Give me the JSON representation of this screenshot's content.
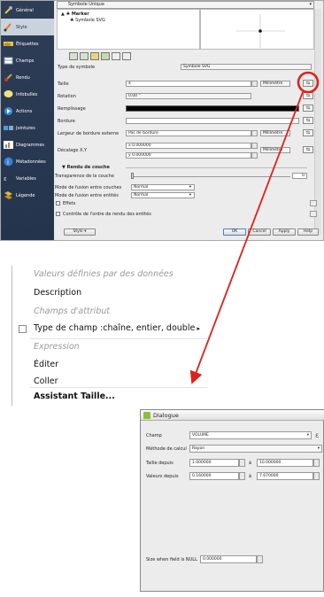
{
  "qgis": {
    "sidebar": [
      {
        "label": "Général",
        "icon": "wrench-icon"
      },
      {
        "label": "Style",
        "icon": "paintbrush-icon"
      },
      {
        "label": "Étiquettes",
        "icon": "labels-icon"
      },
      {
        "label": "Champs",
        "icon": "fields-icon"
      },
      {
        "label": "Rendu",
        "icon": "rendering-icon"
      },
      {
        "label": "Infobulles",
        "icon": "tooltip-icon"
      },
      {
        "label": "Actions",
        "icon": "actions-icon"
      },
      {
        "label": "Jointures",
        "icon": "joins-icon"
      },
      {
        "label": "Diagrammes",
        "icon": "diagram-icon"
      },
      {
        "label": "Métadonnées",
        "icon": "info-icon"
      },
      {
        "label": "Variables",
        "icon": "variables-icon"
      },
      {
        "label": "Légende",
        "icon": "legend-icon"
      }
    ],
    "renderer": "Symbole Unique",
    "tree": {
      "root": "Marker",
      "child": "Symbole SVG"
    },
    "symbol_type_label": "Type de symbole",
    "symbol_type_value": "Symbole SVG",
    "taille_label": "Taille",
    "taille_value": "4",
    "unit_millimetre": "Millimètre",
    "rotation_label": "Rotation",
    "rotation_value": "0.00 °",
    "remplissage_label": "Remplissage",
    "bordure_label": "Bordure",
    "largeur_label": "Largeur de bordure externe",
    "largeur_value": "Pas de bordure",
    "decalage_label": "Décalage X,Y",
    "decalage_x": "x 0.000000",
    "decalage_y": "y 0.000000",
    "section_title": "Rendu de couche",
    "transparence_label": "Transparence de la couche",
    "transparence_value": "0",
    "fusion_couches_label": "Mode de fusion entre couches",
    "fusion_entites_label": "Mode de fusion entre entités",
    "normal": "Normal",
    "effets_label": "Effets",
    "controle_label": "Contrôle de l'ordre de rendu des entités",
    "style_btn": "Style",
    "ok_btn": "OK",
    "cancel_btn": "Cancel",
    "apply_btn": "Apply",
    "help_btn": "Help"
  },
  "menu": {
    "valeurs": "Valeurs définies par des données",
    "description": "Description",
    "champs": "Champs d'attribut",
    "type_champ": "Type de champ :chaîne, entier, double",
    "expression": "Expression",
    "editer": "Éditer",
    "coller": "Coller",
    "assistant": "Assistant Taille..."
  },
  "dialog": {
    "title": "Dialogue",
    "champ_label": "Champ",
    "champ_value": "VOLUME",
    "epsilon": "ε",
    "methode_label": "Méthode de calcul",
    "methode_value": "Rayon",
    "taille_label": "Taille depuis",
    "taille_from": "1.000000",
    "a": "à",
    "taille_to": "10.000000",
    "valeurs_label": "Valeurs depuis",
    "valeurs_from": "0.160000",
    "valeurs_to": "7.670000",
    "null_label": "Size when field is NULL",
    "null_value": "0.000000"
  },
  "colors": {
    "highlight": "#e0201a",
    "sidebar": "#2e3e56"
  }
}
